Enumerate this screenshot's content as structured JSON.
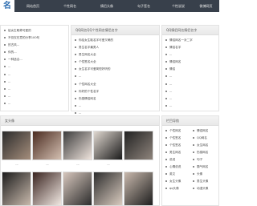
{
  "nav": {
    "logo": "名",
    "items": [
      "网站首页",
      "个性网名",
      "情侣头像",
      "句子签名",
      "个性说说",
      "微博网页"
    ]
  },
  "left_panel": {
    "items": [
      "给女生昵称可爱的",
      "不仅仅在意的分享100句",
      "的古风...",
      "你的...",
      "一种适合...",
      "...",
      "...",
      "...",
      "...",
      "...",
      "..."
    ]
  },
  "middle_panel": {
    "title": "QQ网名QQ个性网名情侣名字",
    "items": [
      "你给女生取名字可爱又萌的",
      "男生名字最男人",
      "男生网名大全",
      "个性签名大全",
      "女生名字可爱简短好听的",
      "...",
      "个性网名大全",
      "你好的个性名字",
      "伤感情侣网名",
      "...",
      "..."
    ]
  },
  "right_panel": {
    "title": "QQ情侣网名情侣名字",
    "items": [
      "情侣网名一对二字",
      "情侣名字",
      "...",
      "情侣网名",
      "情侣",
      "...",
      "...",
      "...",
      "...",
      "..."
    ]
  },
  "photo_section": {
    "title": "女头像",
    "captions": [
      "...",
      "...",
      "...",
      "...",
      "...",
      "...",
      "...",
      "..."
    ]
  },
  "category_section": {
    "title": "栏目导航",
    "items": [
      "个性网名",
      "情侣网名",
      "个性签名",
      "QQ网名",
      "个性签名",
      "女生网名",
      "男生网名",
      "伤感网名",
      "说说",
      "句子",
      "心情说说",
      "霸气网名",
      "英文",
      "头像",
      "女生头像",
      "男生头像",
      "qq头像",
      "动漫头像"
    ]
  },
  "colors": {
    "nav_bg": "#38404b",
    "logo_blue": "#2b6cb0"
  }
}
